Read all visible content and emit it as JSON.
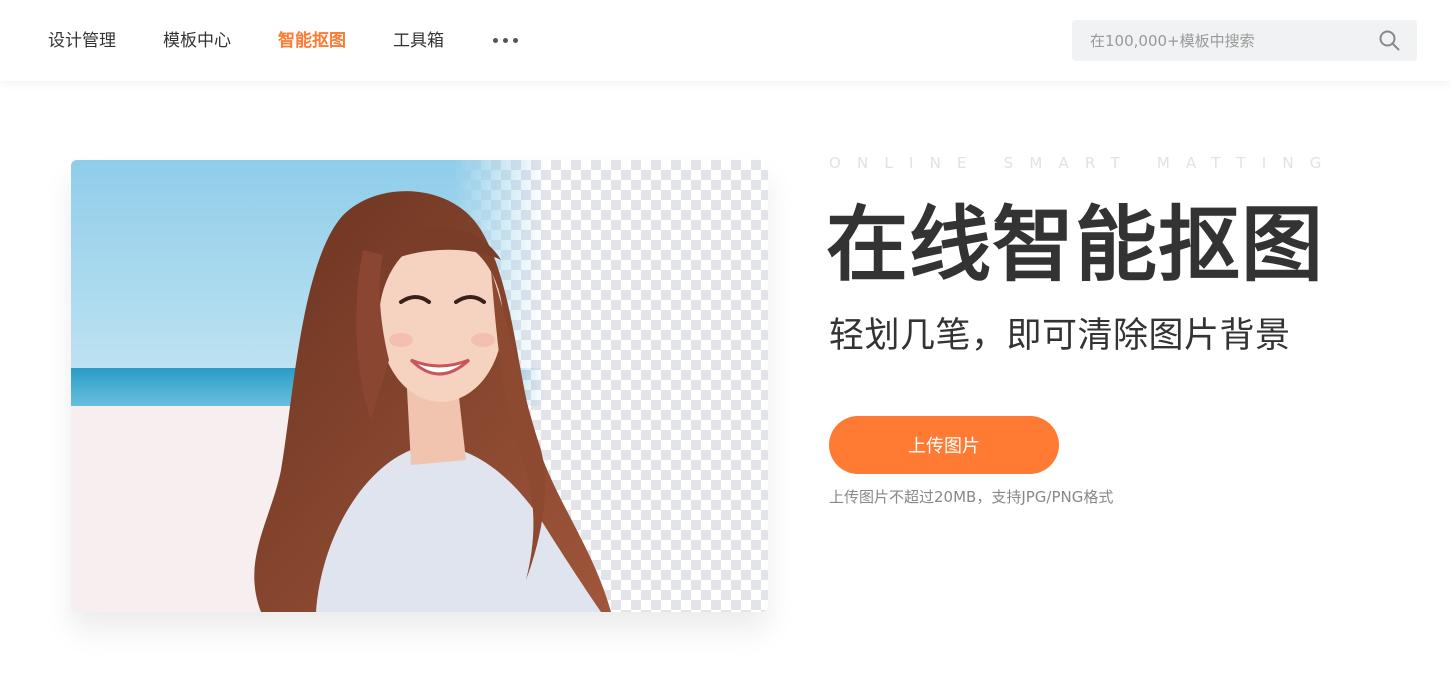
{
  "colors": {
    "accent": "#ff7a33",
    "text": "#333333",
    "muted": "#888888",
    "search_bg": "#f1f2f4"
  },
  "nav": {
    "items": [
      {
        "label": "设计管理",
        "active": false
      },
      {
        "label": "模板中心",
        "active": false
      },
      {
        "label": "智能抠图",
        "active": true
      },
      {
        "label": "工具箱",
        "active": false
      }
    ],
    "more_icon": "more-dots-icon"
  },
  "search": {
    "placeholder": "在100,000+模板中搜索",
    "value": "",
    "icon": "search-icon"
  },
  "hero": {
    "eyebrow": "ONLINE SMART MATTING",
    "title": "在线智能抠图",
    "subtitle": "轻划几笔，即可清除图片背景",
    "upload_label": "上传图片",
    "upload_hint": "上传图片不超过20MB，支持JPG/PNG格式"
  }
}
